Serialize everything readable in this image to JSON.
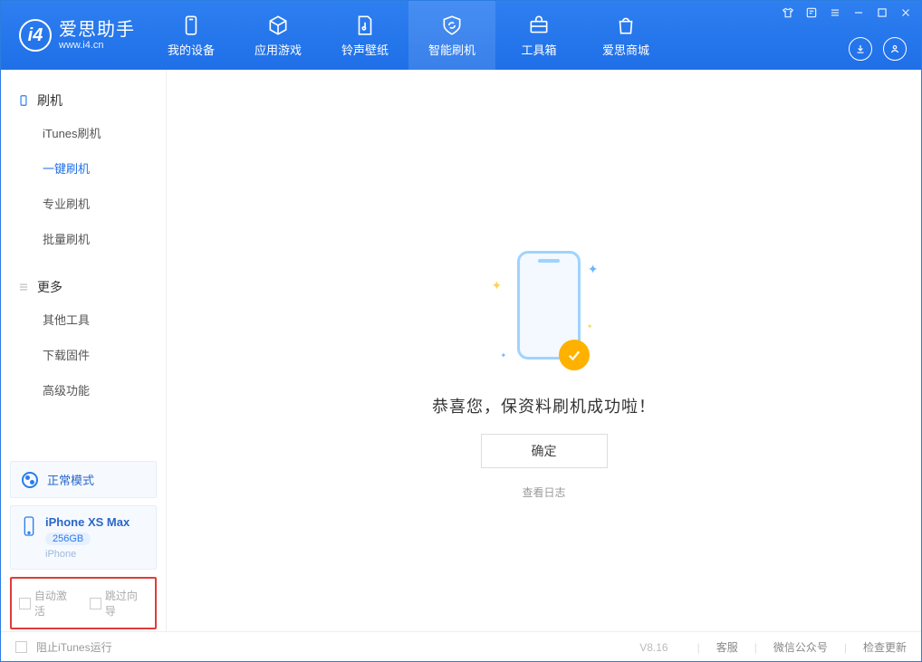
{
  "app": {
    "name": "爱思助手",
    "domain": "www.i4.cn"
  },
  "nav": {
    "items": [
      {
        "label": "我的设备"
      },
      {
        "label": "应用游戏"
      },
      {
        "label": "铃声壁纸"
      },
      {
        "label": "智能刷机"
      },
      {
        "label": "工具箱"
      },
      {
        "label": "爱思商城"
      }
    ],
    "active_index": 3
  },
  "sidebar": {
    "group_flash": "刷机",
    "items_flash": [
      {
        "label": "iTunes刷机"
      },
      {
        "label": "一键刷机"
      },
      {
        "label": "专业刷机"
      },
      {
        "label": "批量刷机"
      }
    ],
    "active_flash_index": 1,
    "group_more": "更多",
    "items_more": [
      {
        "label": "其他工具"
      },
      {
        "label": "下载固件"
      },
      {
        "label": "高级功能"
      }
    ]
  },
  "mode": {
    "label": "正常模式"
  },
  "device": {
    "name": "iPhone XS Max",
    "storage": "256GB",
    "type": "iPhone"
  },
  "options": {
    "auto_activate": "自动激活",
    "skip_guide": "跳过向导"
  },
  "result": {
    "message": "恭喜您，保资料刷机成功啦！",
    "ok": "确定",
    "view_log": "查看日志"
  },
  "status": {
    "block_itunes": "阻止iTunes运行",
    "version": "V8.16",
    "links": [
      "客服",
      "微信公众号",
      "检查更新"
    ]
  }
}
